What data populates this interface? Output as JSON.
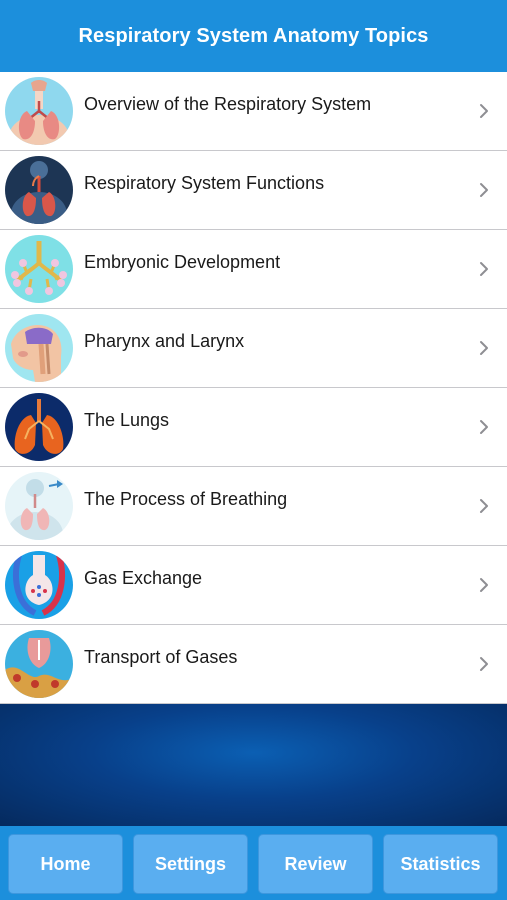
{
  "header": {
    "title": "Respiratory System Anatomy Topics"
  },
  "topics": [
    {
      "label": "Overview of the Respiratory System",
      "icon": "respiratory-overview-icon"
    },
    {
      "label": "Respiratory System Functions",
      "icon": "respiratory-functions-icon"
    },
    {
      "label": "Embryonic Development",
      "icon": "embryonic-development-icon"
    },
    {
      "label": "Pharynx and Larynx",
      "icon": "pharynx-larynx-icon"
    },
    {
      "label": "The Lungs",
      "icon": "lungs-icon"
    },
    {
      "label": "The Process of Breathing",
      "icon": "breathing-icon"
    },
    {
      "label": "Gas Exchange",
      "icon": "gas-exchange-icon"
    },
    {
      "label": "Transport of Gases",
      "icon": "gas-transport-icon"
    }
  ],
  "tabbar": {
    "home_label": "Home",
    "settings_label": "Settings",
    "review_label": "Review",
    "statistics_label": "Statistics"
  },
  "colors": {
    "header": "#1c8fdc",
    "tab_button": "#5aaef0",
    "banner": "#08408a"
  }
}
